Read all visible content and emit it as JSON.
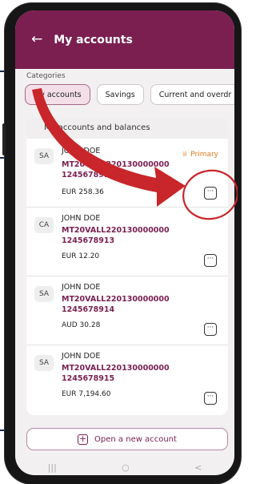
{
  "header": {
    "back_icon": "arrow-left-icon",
    "title": "My accounts"
  },
  "categories": {
    "label": "Categories",
    "chips": [
      {
        "label": "My accounts",
        "active": true
      },
      {
        "label": "Savings",
        "active": false
      },
      {
        "label": "Current and overdr",
        "active": false
      }
    ]
  },
  "section": {
    "title": "My accounts and balances"
  },
  "accounts": [
    {
      "type": "SA",
      "name": "JOHN DOE",
      "iban_line1": "MT20VALL220130000000",
      "iban_line2": "1245678912",
      "amount": "EUR 258.36",
      "primary": "Primary"
    },
    {
      "type": "CA",
      "name": "JOHN DOE",
      "iban_line1": "MT20VALL220130000000",
      "iban_line2": "1245678913",
      "amount": "EUR 12.20"
    },
    {
      "type": "SA",
      "name": "JOHN DOE",
      "iban_line1": "MT20VALL220130000000",
      "iban_line2": "1245678914",
      "amount": "AUD 30.28"
    },
    {
      "type": "SA",
      "name": "JOHN DOE",
      "iban_line1": "MT20VALL220130000000",
      "iban_line2": "1245678915",
      "amount": "EUR 7,194.60"
    }
  ],
  "open_account": {
    "label": "Open a new account",
    "icon": "plus-square-icon"
  },
  "nav_bar": {
    "recents": "|||",
    "home": "○",
    "back": "<"
  },
  "annotation": {
    "arrow_color": "#c8262a",
    "circle_color": "#c8262a"
  }
}
